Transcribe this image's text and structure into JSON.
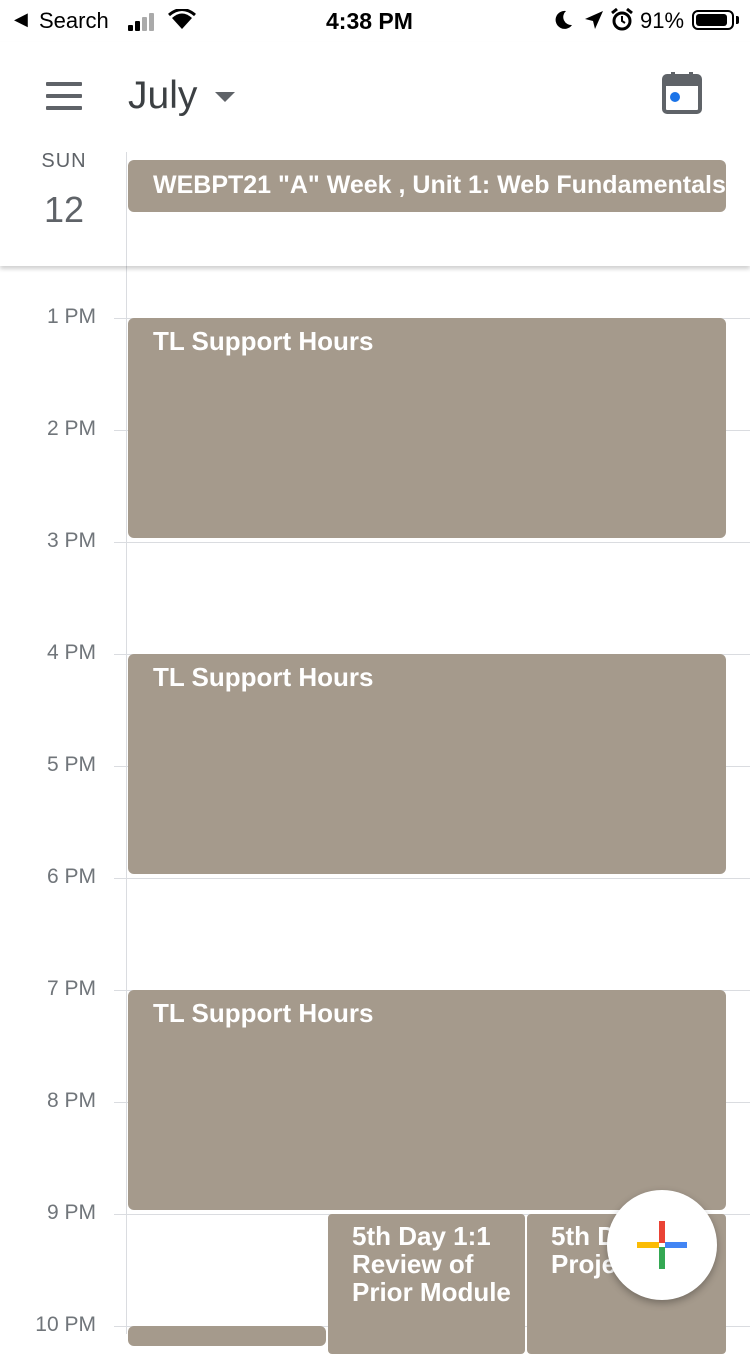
{
  "status_bar": {
    "back_label": "Search",
    "time": "4:38 PM",
    "battery_pct": "91%",
    "battery_level": 0.91
  },
  "header": {
    "month": "July",
    "day_name": "SUN",
    "day_number": "12"
  },
  "all_day_event": {
    "title": "WEBPT21 \"A\" Week ,  Unit 1: Web Fundamentals"
  },
  "hours": [
    "1 PM",
    "2 PM",
    "3 PM",
    "4 PM",
    "5 PM",
    "6 PM",
    "7 PM",
    "8 PM",
    "9 PM",
    "10 PM"
  ],
  "events": [
    {
      "title": "TL Support Hours"
    },
    {
      "title": "TL Support Hours"
    },
    {
      "title": "TL Support Hours"
    },
    {
      "title": "5th Day 1:1 Review of Prior Module"
    },
    {
      "title": "5th Day Project Time"
    }
  ],
  "colors": {
    "event": "#a59a8c",
    "fab_plus": [
      "#ea4335",
      "#4285f4",
      "#34a853",
      "#fbbc05"
    ]
  }
}
